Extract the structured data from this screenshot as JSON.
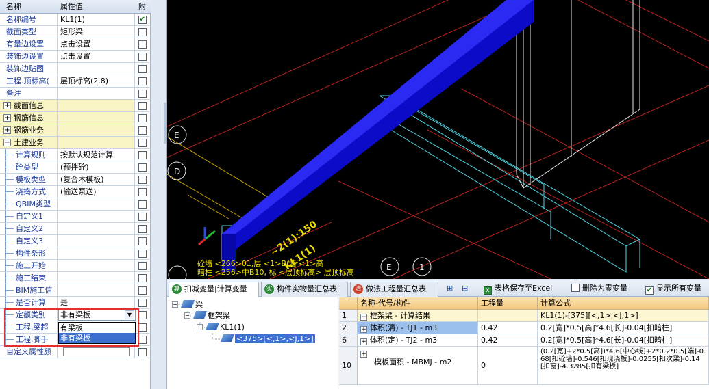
{
  "props": {
    "header": {
      "name_col": "名称",
      "value_col": "属性值",
      "attach_col": "附"
    },
    "rows": [
      {
        "name": "名称编号",
        "value": "KL1(1)",
        "checked": true,
        "kind": "plain"
      },
      {
        "name": "截面类型",
        "value": "矩形梁",
        "checked": false,
        "kind": "plain"
      },
      {
        "name": "有量边设置",
        "value": "点击设置",
        "checked": false,
        "kind": "plain"
      },
      {
        "name": "装饰边设置",
        "value": "点击设置",
        "checked": false,
        "kind": "plain"
      },
      {
        "name": "装饰边贴图",
        "value": "",
        "checked": false,
        "kind": "plain"
      },
      {
        "name": "工程.顶标高(",
        "value": "层顶标高(2.8)",
        "checked": false,
        "kind": "plain"
      },
      {
        "name": "备注",
        "value": "",
        "checked": false,
        "kind": "plain"
      },
      {
        "name": "截面信息",
        "value": "",
        "checked": false,
        "kind": "group",
        "expander": "+"
      },
      {
        "name": "钢筋信息",
        "value": "",
        "checked": false,
        "kind": "group",
        "expander": "+"
      },
      {
        "name": "钢筋业务",
        "value": "",
        "checked": false,
        "kind": "group",
        "expander": "+"
      },
      {
        "name": "土建业务",
        "value": "",
        "checked": false,
        "kind": "group",
        "expander": "−"
      },
      {
        "name": "计算规则",
        "value": "按默认规范计算",
        "checked": false,
        "kind": "child"
      },
      {
        "name": "砼类型",
        "value": "(预拌砼)",
        "checked": false,
        "kind": "child"
      },
      {
        "name": "模板类型",
        "value": "(复合木模板)",
        "checked": false,
        "kind": "child"
      },
      {
        "name": "浇捣方式",
        "value": "(输送泵送)",
        "checked": false,
        "kind": "child"
      },
      {
        "name": "QBIM类型",
        "value": "",
        "checked": false,
        "kind": "child"
      },
      {
        "name": "自定义1",
        "value": "",
        "checked": false,
        "kind": "child"
      },
      {
        "name": "自定义2",
        "value": "",
        "checked": false,
        "kind": "child"
      },
      {
        "name": "自定义3",
        "value": "",
        "checked": false,
        "kind": "child"
      },
      {
        "name": "构件条形",
        "value": "",
        "checked": false,
        "kind": "child"
      },
      {
        "name": "施工开始",
        "value": "",
        "checked": false,
        "kind": "child"
      },
      {
        "name": "施工结束",
        "value": "",
        "checked": false,
        "kind": "child"
      },
      {
        "name": "BIM施工信",
        "value": "",
        "checked": false,
        "kind": "child"
      },
      {
        "name": "是否计算",
        "value": "是",
        "checked": false,
        "kind": "child"
      },
      {
        "name": "定额类别",
        "value": "非有梁板",
        "checked": false,
        "kind": "child-dropdown"
      },
      {
        "name": "工程.梁超",
        "value": "",
        "checked": false,
        "kind": "child"
      },
      {
        "name": "工程.脚手",
        "value": "",
        "checked": false,
        "kind": "child"
      },
      {
        "name": "自定义属性颜",
        "value": "",
        "checked": false,
        "kind": "plain"
      }
    ],
    "dropdown_options": [
      "有梁板",
      "非有梁板"
    ],
    "dropdown_selected": "非有梁板"
  },
  "view": {
    "annotation_line1": "砼墙 <266>01,层 <1>B,墙 <1>高",
    "annotation_line2": "暗柱 <256>中B10, 标 <层顶标高> 层顶标高",
    "axis_labels": [
      "E",
      "D",
      "E",
      "1"
    ]
  },
  "bottom": {
    "tabs": [
      {
        "icon": "算",
        "icon_color": "#2a8a3a",
        "label": "扣减变量|计算变量",
        "active": true
      },
      {
        "icon": "实",
        "icon_color": "#2a8a3a",
        "label": "构件实物量汇总表",
        "active": false
      },
      {
        "icon": "清",
        "icon_color": "#d0402a",
        "label": "做法工程量汇总表",
        "active": false
      }
    ],
    "toolbar": {
      "save_excel": "表格保存至Excel",
      "delete_zero": "删除为零变量",
      "show_all": "显示所有变量",
      "show_all_checked": true
    },
    "tree": [
      {
        "label": "梁",
        "level": 0
      },
      {
        "label": "框架梁",
        "level": 1
      },
      {
        "label": "KL1(1)",
        "level": 2
      },
      {
        "label": "<375>[<,1>,<J,1>]",
        "level": 3,
        "selected": true
      }
    ],
    "grid": {
      "headers": [
        "名称-代号/构件",
        "工程量",
        "计算公式"
      ],
      "rows": [
        {
          "num": "1",
          "name": "框架梁 - 计算结果",
          "qty": "",
          "formula": "KL1(1)-[375][<,1>,<J,1>]",
          "kind": "total",
          "exp": "−"
        },
        {
          "num": "2",
          "name": "体积(清) - TJ1 - m3",
          "qty": "0.42",
          "formula": "0.2[宽]*0.5[高]*4.6[长]-0.04[扣暗柱]",
          "kind": "sel",
          "exp": "+"
        },
        {
          "num": "6",
          "name": "体积(定) - TJ2 - m3",
          "qty": "0.42",
          "formula": "0.2[宽]*0.5[高]*4.6[长]-0.04[扣暗柱]",
          "kind": "normal",
          "exp": "+"
        },
        {
          "num": "10",
          "name": "模板面积 - MBMJ - m2",
          "qty": "0",
          "formula": "(0.2[宽]+2*0.5[高])*4.6[中心线]+2*0.2*0.5[端]-0.68[扣砼墙]-0.546[扣现浇板]-0.0255[扣次梁]-0.14[扣窗]-4.3285[扣有梁板]",
          "kind": "tall",
          "exp": "+"
        }
      ]
    }
  }
}
